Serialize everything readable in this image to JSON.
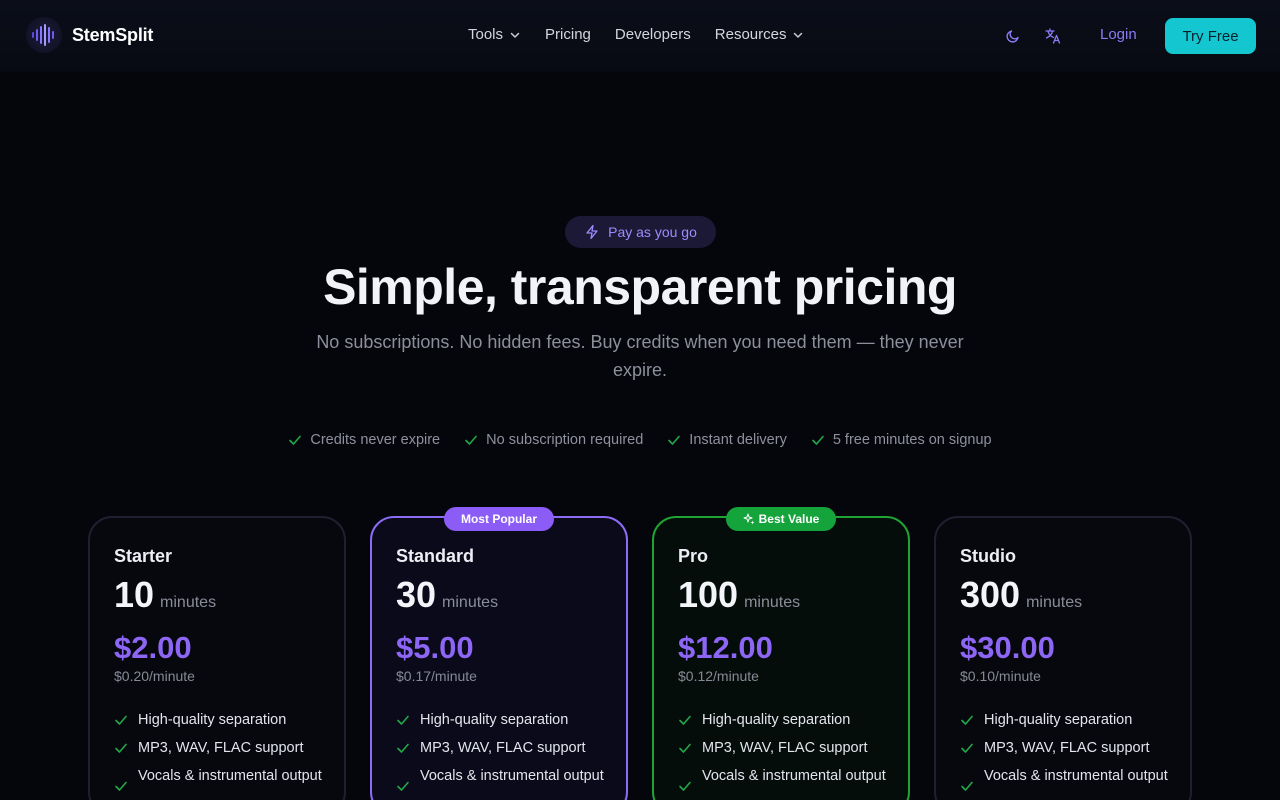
{
  "brand": {
    "name": "StemSplit"
  },
  "nav": [
    {
      "label": "Tools",
      "dropdown": true
    },
    {
      "label": "Pricing",
      "dropdown": false
    },
    {
      "label": "Developers",
      "dropdown": false
    },
    {
      "label": "Resources",
      "dropdown": true
    }
  ],
  "header": {
    "theme_icon": "moon-icon",
    "language_icon": "translate-icon",
    "login_label": "Login",
    "cta_label": "Try Free"
  },
  "hero": {
    "pill": "Pay as you go",
    "title": "Simple, transparent pricing",
    "subtitle": "No subscriptions. No hidden fees. Buy credits when you need them — they never expire.",
    "features": [
      "Credits never expire",
      "No subscription required",
      "Instant delivery",
      "5 free minutes on signup"
    ]
  },
  "plans": [
    {
      "name": "Starter",
      "minutes": "10",
      "unit": "minutes",
      "price": "$2.00",
      "rate": "$0.20/minute",
      "features": [
        "High-quality separation",
        "MP3, WAV, FLAC support",
        "Vocals & instrumental output"
      ]
    },
    {
      "name": "Standard",
      "badge": "Most Popular",
      "minutes": "30",
      "unit": "minutes",
      "price": "$5.00",
      "rate": "$0.17/minute",
      "features": [
        "High-quality separation",
        "MP3, WAV, FLAC support",
        "Vocals & instrumental output"
      ]
    },
    {
      "name": "Pro",
      "badge": "Best Value",
      "minutes": "100",
      "unit": "minutes",
      "price": "$12.00",
      "rate": "$0.12/minute",
      "features": [
        "High-quality separation",
        "MP3, WAV, FLAC support",
        "Vocals & instrumental output"
      ]
    },
    {
      "name": "Studio",
      "minutes": "300",
      "unit": "minutes",
      "price": "$30.00",
      "rate": "$0.10/minute",
      "features": [
        "High-quality separation",
        "MP3, WAV, FLAC support",
        "Vocals & instrumental output"
      ]
    }
  ],
  "colors": {
    "accent_purple": "#8b5cf6",
    "accent_cyan": "#14c6cf",
    "accent_green": "#15a33b",
    "check_green": "#22a84a"
  }
}
